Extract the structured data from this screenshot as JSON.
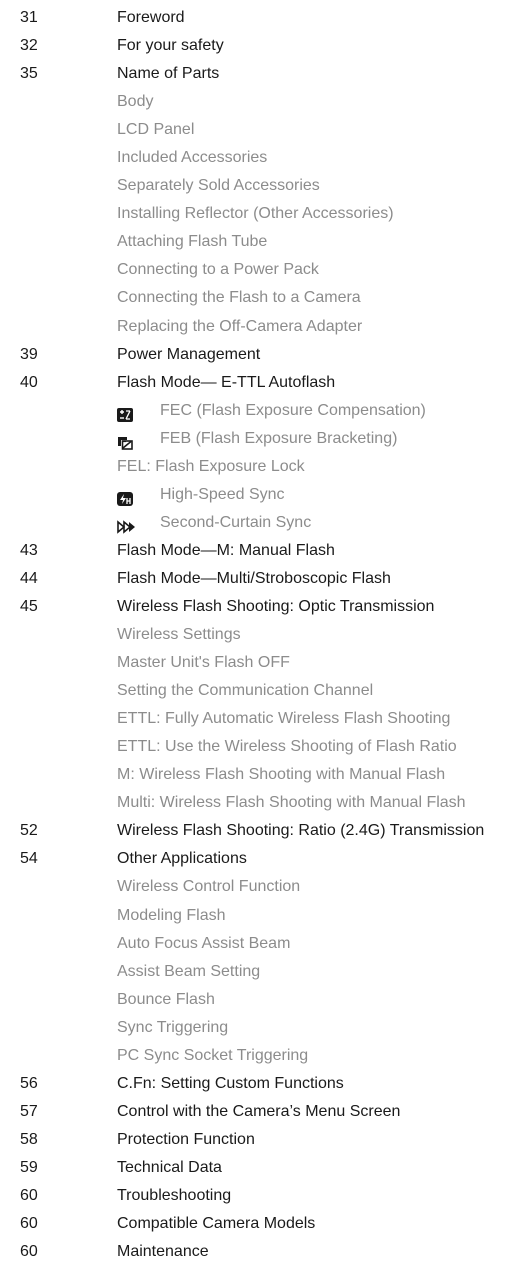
{
  "toc": [
    {
      "page": "31",
      "title": "Foreword",
      "level": "main"
    },
    {
      "page": "32",
      "title": "For your safety",
      "level": "main"
    },
    {
      "page": "35",
      "title": "Name of Parts",
      "level": "main"
    },
    {
      "page": "",
      "title": "Body",
      "level": "sub"
    },
    {
      "page": "",
      "title": "LCD Panel",
      "level": "sub"
    },
    {
      "page": "",
      "title": "Included Accessories",
      "level": "sub"
    },
    {
      "page": "",
      "title": "Separately Sold Accessories",
      "level": "sub"
    },
    {
      "page": "",
      "title": "Installing Reflector (Other Accessories)",
      "level": "sub"
    },
    {
      "page": "",
      "title": "Attaching Flash Tube",
      "level": "sub"
    },
    {
      "page": "",
      "title": "Connecting to a Power Pack",
      "level": "sub"
    },
    {
      "page": "",
      "title": "Connecting the Flash to a Camera",
      "level": "sub"
    },
    {
      "page": "",
      "title": "Replacing the Off-Camera Adapter",
      "level": "sub"
    },
    {
      "page": "39",
      "title": "Power Management",
      "level": "main"
    },
    {
      "page": "40",
      "title": "Flash Mode— E-TTL Autoflash",
      "level": "main"
    },
    {
      "page": "",
      "title": "FEC (Flash Exposure Compensation)",
      "level": "sub",
      "icon": "fec-icon"
    },
    {
      "page": "",
      "title": "FEB (Flash Exposure Bracketing)",
      "level": "sub",
      "icon": "feb-icon"
    },
    {
      "page": "",
      "title": "FEL: Flash Exposure Lock",
      "level": "sub"
    },
    {
      "page": "",
      "title": "High-Speed Sync",
      "level": "sub",
      "icon": "high-speed-sync-icon"
    },
    {
      "page": "",
      "title": "Second-Curtain Sync",
      "level": "sub",
      "icon": "second-curtain-sync-icon"
    },
    {
      "page": "43",
      "title": "Flash Mode—M: Manual Flash",
      "level": "main"
    },
    {
      "page": "44",
      "title": "Flash Mode—Multi/Stroboscopic Flash",
      "level": "main"
    },
    {
      "page": "45",
      "title": "Wireless Flash Shooting: Optic Transmission",
      "level": "main"
    },
    {
      "page": "",
      "title": "Wireless Settings",
      "level": "sub"
    },
    {
      "page": "",
      "title": "Master Unit's Flash OFF",
      "level": "sub"
    },
    {
      "page": "",
      "title": "Setting the Communication Channel",
      "level": "sub"
    },
    {
      "page": "",
      "title": "ETTL: Fully Automatic Wireless Flash Shooting",
      "level": "sub"
    },
    {
      "page": "",
      "title": "ETTL: Use the Wireless Shooting of Flash Ratio",
      "level": "sub"
    },
    {
      "page": "",
      "title": "M: Wireless Flash Shooting with Manual Flash",
      "level": "sub"
    },
    {
      "page": "",
      "title": "Multi: Wireless Flash Shooting with Manual Flash",
      "level": "sub"
    },
    {
      "page": "52",
      "title": "Wireless Flash Shooting: Ratio (2.4G) Transmission",
      "level": "main"
    },
    {
      "page": "54",
      "title": "Other Applications",
      "level": "main"
    },
    {
      "page": "",
      "title": "Wireless Control Function",
      "level": "sub"
    },
    {
      "page": "",
      "title": "Modeling Flash",
      "level": "sub"
    },
    {
      "page": "",
      "title": "Auto Focus Assist Beam",
      "level": "sub"
    },
    {
      "page": "",
      "title": "Assist Beam Setting",
      "level": "sub"
    },
    {
      "page": "",
      "title": "Bounce Flash",
      "level": "sub"
    },
    {
      "page": "",
      "title": "Sync Triggering",
      "level": "sub"
    },
    {
      "page": "",
      "title": "PC Sync Socket Triggering",
      "level": "sub"
    },
    {
      "page": "56",
      "title": "C.Fn: Setting Custom Functions",
      "level": "main"
    },
    {
      "page": "57",
      "title": "Control with the Camera’s Menu Screen",
      "level": "main"
    },
    {
      "page": "58",
      "title": "Protection Function",
      "level": "main"
    },
    {
      "page": "59",
      "title": "Technical Data",
      "level": "main"
    },
    {
      "page": "60",
      "title": "Troubleshooting",
      "level": "main"
    },
    {
      "page": "60",
      "title": "Compatible Camera Models",
      "level": "main"
    },
    {
      "page": "60",
      "title": "Maintenance",
      "level": "main"
    }
  ]
}
